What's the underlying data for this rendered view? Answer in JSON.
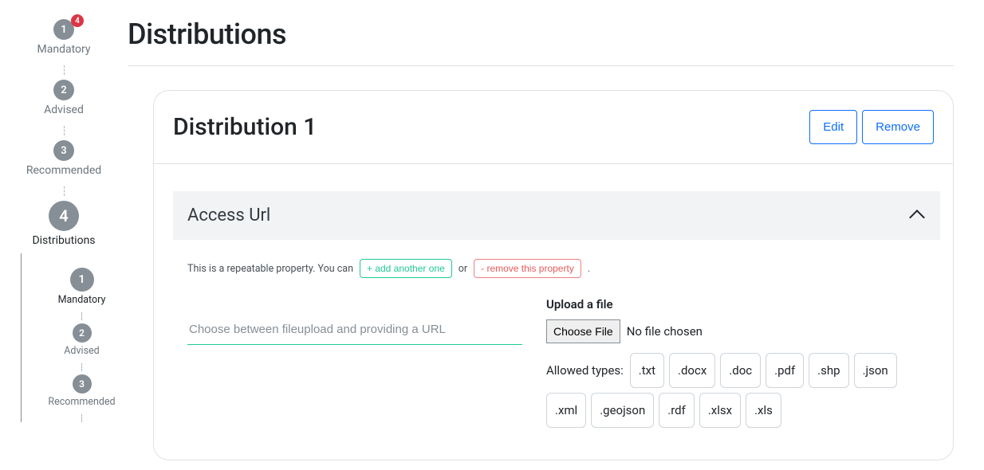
{
  "sidebar": {
    "steps": [
      {
        "num": "1",
        "label": "Mandatory",
        "badge": "4"
      },
      {
        "num": "2",
        "label": "Advised"
      },
      {
        "num": "3",
        "label": "Recommended"
      },
      {
        "num": "4",
        "label": "Distributions"
      }
    ],
    "substeps": [
      {
        "num": "1",
        "label": "Mandatory"
      },
      {
        "num": "2",
        "label": "Advised"
      },
      {
        "num": "3",
        "label": "Recommended"
      }
    ]
  },
  "page": {
    "title": "Distributions"
  },
  "card": {
    "title": "Distribution 1",
    "edit": "Edit",
    "remove": "Remove"
  },
  "accordion": {
    "title": "Access Url"
  },
  "repeat": {
    "prefix": "This is a repeatable property. You can",
    "add": "+ add another one",
    "or": "or",
    "remove": "- remove this property",
    "suffix": "."
  },
  "url": {
    "placeholder": "Choose between fileupload and providing a URL"
  },
  "upload": {
    "label": "Upload a file",
    "choose": "Choose File",
    "status": "No file chosen",
    "allowed_label": "Allowed types:",
    "types": [
      ".txt",
      ".docx",
      ".doc",
      ".pdf",
      ".shp",
      ".json",
      ".xml",
      ".geojson",
      ".rdf",
      ".xlsx",
      ".xls"
    ]
  }
}
